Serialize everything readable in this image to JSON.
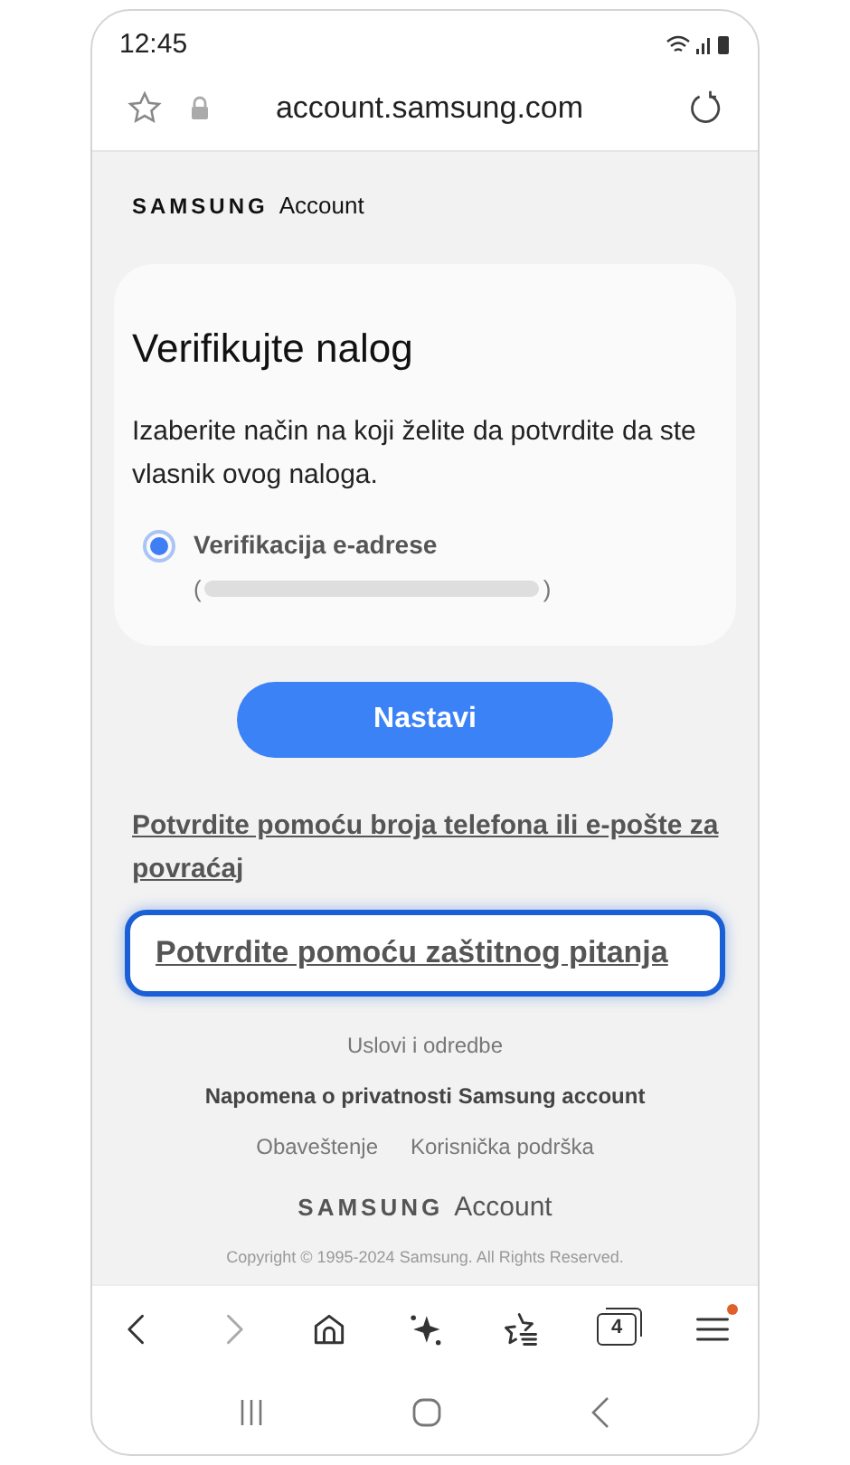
{
  "status_bar": {
    "time": "12:45"
  },
  "address_bar": {
    "url": "account.samsung.com"
  },
  "header": {
    "brand": "SAMSUNG",
    "product": "Account"
  },
  "card": {
    "title": "Verifikujte nalog",
    "description": "Izaberite način na koji želite da potvrdite da ste vlasnik ovog naloga.",
    "options": [
      {
        "label": "Verifikacija e-adrese",
        "open_paren": "(",
        "close_paren": ")",
        "selected": true
      }
    ]
  },
  "continue_button": "Nastavi",
  "links": [
    {
      "text": "Potvrdite pomoću broja telefona ili e-pošte za povraćaj",
      "highlighted": false
    },
    {
      "text": "Potvrdite pomoću zaštitnog pitanja",
      "highlighted": true
    }
  ],
  "footer": {
    "terms": "Uslovi i odredbe",
    "privacy": "Napomena o privatnosti Samsung account",
    "notice": "Obaveštenje",
    "support": "Korisnička podrška",
    "brand": "SAMSUNG",
    "product": "Account",
    "copyright": "Copyright © 1995-2024 Samsung. All Rights Reserved."
  },
  "toolbar": {
    "tab_count": "4",
    "menu_badge": true
  }
}
